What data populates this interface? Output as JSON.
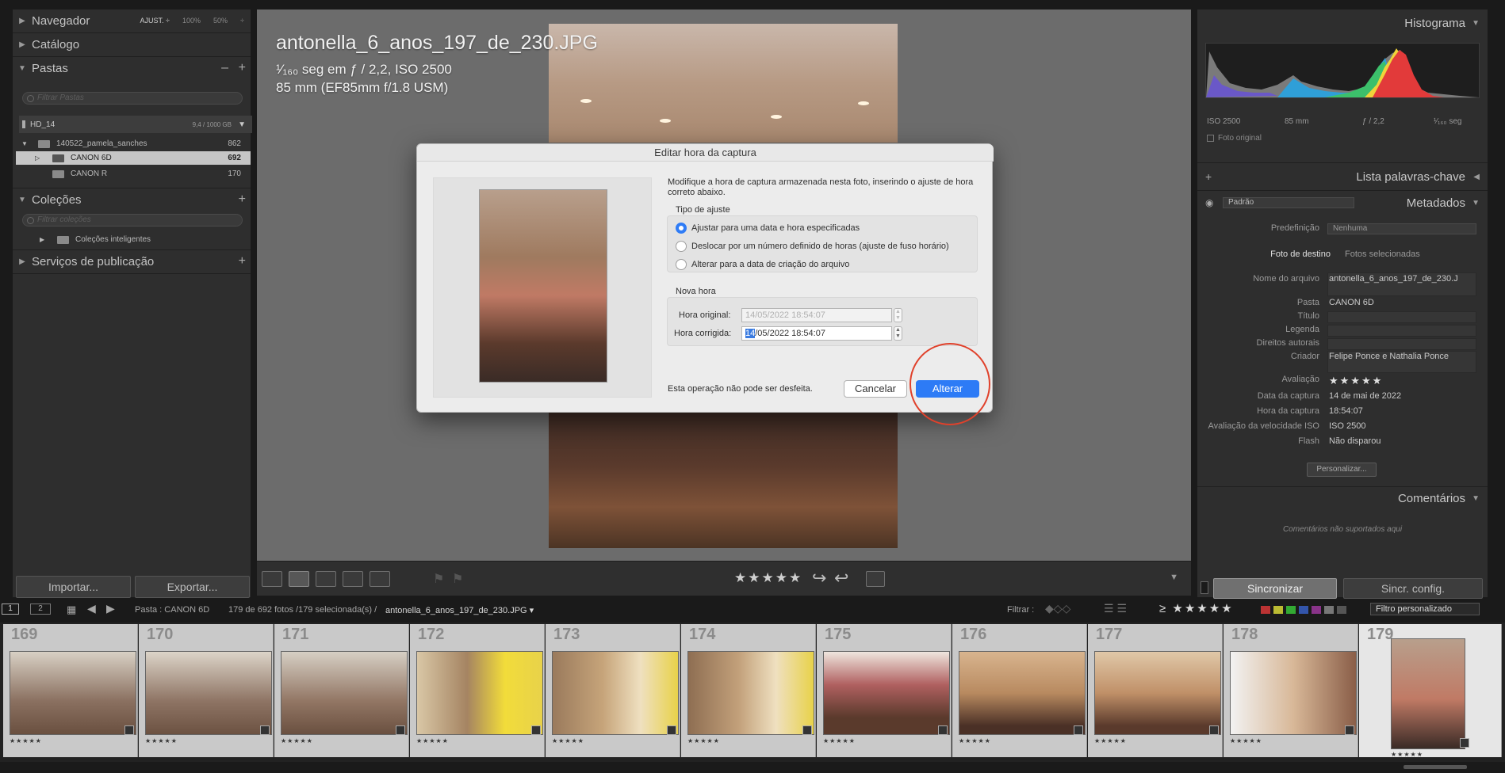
{
  "left_panel": {
    "navigator": {
      "label": "Navegador",
      "opt_fit": "AJUST. ÷",
      "opt_100": "100%",
      "opt_50": "50%"
    },
    "catalog": {
      "label": "Catálogo"
    },
    "folders": {
      "label": "Pastas",
      "search_placeholder": "Filtrar Pastas",
      "volume": {
        "name": "HD_14",
        "size": "9,4 / 1000 GB"
      },
      "items": [
        {
          "name": "140522_pamela_sanches",
          "count": "862"
        },
        {
          "name": "CANON 6D",
          "count": "692"
        },
        {
          "name": "CANON R",
          "count": "170"
        }
      ]
    },
    "collections": {
      "label": "Coleções",
      "search_placeholder": "Filtrar coleções",
      "smart": "Coleções inteligentes"
    },
    "publish": {
      "label": "Serviços de publicação"
    },
    "import_label": "Importar...",
    "export_label": "Exportar..."
  },
  "overlay": {
    "filename": "antonella_6_anos_197_de_230.JPG",
    "exposure": "¹⁄₁₆₀ seg em ƒ / 2,2, ISO 2500",
    "lens": "85 mm (EF85mm f/1.8 USM)"
  },
  "dialog": {
    "title": "Editar hora da captura",
    "description": "Modifique a hora de captura armazenada nesta foto, inserindo o ajuste de hora correto abaixo.",
    "adjust_group_label": "Tipo de ajuste",
    "options": [
      "Ajustar para uma data e hora especificadas",
      "Deslocar por um número definido de horas (ajuste de fuso horário)",
      "Alterar para a data de criação do arquivo"
    ],
    "new_time_label": "Nova hora",
    "original_label": "Hora original:",
    "original_value": "14/05/2022  18:54:07",
    "corrected_label": "Hora corrigida:",
    "corrected_day": "14",
    "corrected_rest": "/05/2022  18:54:07",
    "warning": "Esta operação não pode ser desfeita.",
    "cancel": "Cancelar",
    "confirm": "Alterar"
  },
  "toolbar": {
    "stars": "★★★★★"
  },
  "right_panel": {
    "histogram": {
      "label": "Histograma",
      "iso": "ISO 2500",
      "focal": "85 mm",
      "aperture": "ƒ / 2,2",
      "shutter": "¹⁄₁₆₀ seg",
      "original_photo": "Foto original"
    },
    "keywords": {
      "label": "Lista palavras-chave"
    },
    "metadata": {
      "label": "Metadados",
      "preset_dropdown": "Padrão",
      "preset_label": "Predefinição",
      "preset_value": "Nenhuma",
      "tab_target": "Foto de destino",
      "tab_selected": "Fotos selecionadas",
      "rows": [
        {
          "k": "Nome do arquivo",
          "v": "antonella_6_anos_197_de_230.J"
        },
        {
          "k": "Pasta",
          "v": "CANON 6D"
        },
        {
          "k": "Título",
          "v": ""
        },
        {
          "k": "Legenda",
          "v": ""
        },
        {
          "k": "Direitos autorais",
          "v": ""
        },
        {
          "k": "Criador",
          "v": "Felipe Ponce e Nathalia Ponce"
        },
        {
          "k": "Avaliação",
          "v": "★★★★★"
        },
        {
          "k": "Data da captura",
          "v": "14 de mai de 2022"
        },
        {
          "k": "Hora da captura",
          "v": "18:54:07"
        },
        {
          "k": "Avaliação da velocidade ISO",
          "v": "ISO 2500"
        },
        {
          "k": "Flash",
          "v": "Não disparou"
        }
      ],
      "customize": "Personalizar..."
    },
    "comments": {
      "label": "Comentários",
      "note": "Comentários não suportados aqui"
    },
    "sync": "Sincronizar",
    "sync_settings": "Sincr. config."
  },
  "filmstrip_bar": {
    "view1": "1",
    "view2": "2",
    "source": "Pasta : CANON 6D",
    "count": "179 de 692 fotos /179 selecionada(s) /",
    "current": "antonella_6_anos_197_de_230.JPG ▾",
    "filter_label": "Filtrar :",
    "filter_stars": "≥ ★★★★★",
    "filter_preset": "Filtro personalizado"
  },
  "filmstrip": [
    {
      "num": "169",
      "stars": "★★★★★"
    },
    {
      "num": "170",
      "stars": "★★★★★"
    },
    {
      "num": "171",
      "stars": "★★★★★"
    },
    {
      "num": "172",
      "stars": "★★★★★"
    },
    {
      "num": "173",
      "stars": "★★★★★"
    },
    {
      "num": "174",
      "stars": "★★★★★"
    },
    {
      "num": "175",
      "stars": "★★★★★"
    },
    {
      "num": "176",
      "stars": "★★★★★"
    },
    {
      "num": "177",
      "stars": "★★★★★"
    },
    {
      "num": "178",
      "stars": "★★★★★"
    },
    {
      "num": "179",
      "stars": "★★★★★"
    }
  ],
  "colors": {
    "accent": "#2d7bf6",
    "highlight_ring": "#e0412b"
  }
}
